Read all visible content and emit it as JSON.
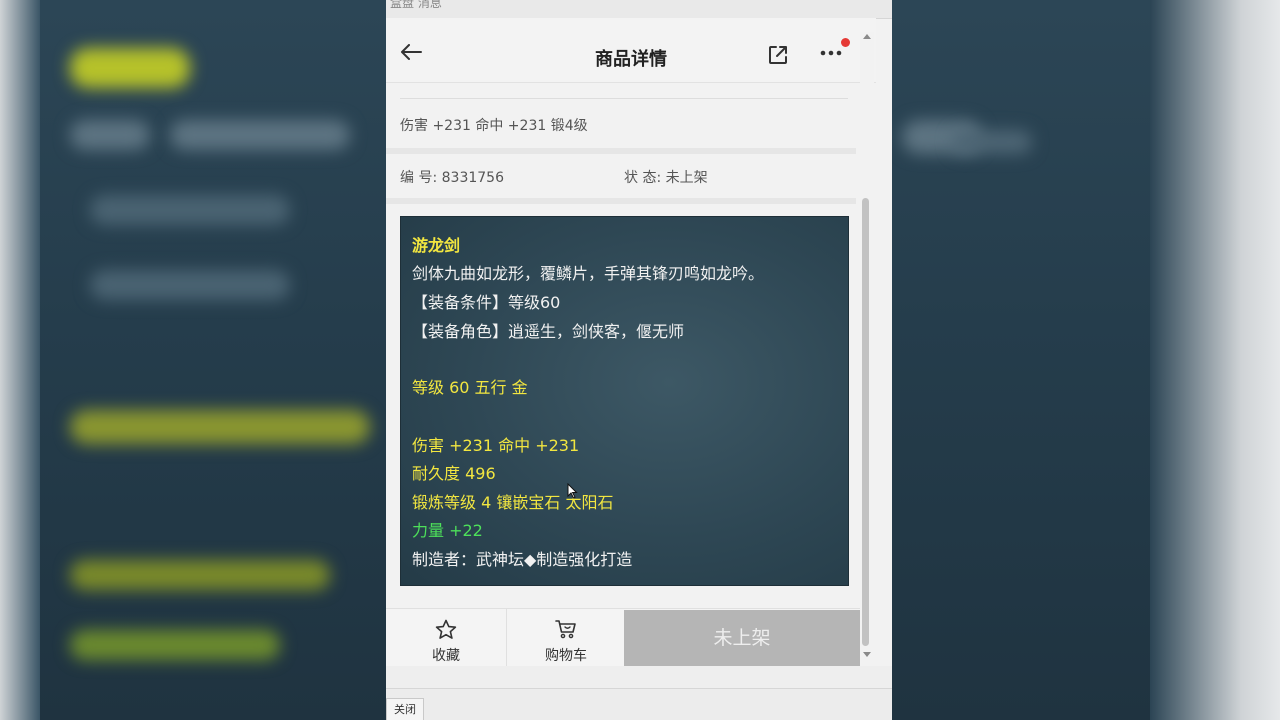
{
  "window": {
    "top_strip_text": "盒盘 消息",
    "footer_close": "关闭"
  },
  "nav": {
    "title": "商品详情",
    "back_icon": "arrow-left-icon",
    "share_icon": "external-link-icon",
    "more_icon": "more-dots-icon",
    "badge_color": "#e53935"
  },
  "item": {
    "stats": "伤害 +231 命中 +231 锻4级",
    "id_label": "编 号:",
    "id_value": "8331756",
    "status_label": "状 态:",
    "status_value": "未上架"
  },
  "description": {
    "name": "游龙剑",
    "flavor": "剑体九曲如龙形，覆鳞片，手弹其锋刃鸣如龙吟。",
    "requirement": "【装备条件】等级60",
    "roles": "【装备角色】逍遥生，剑侠客，偃无师",
    "level_element": "等级 60 五行 金",
    "attack": "伤害 +231 命中 +231",
    "durability": "耐久度 496",
    "forge": "锻炼等级 4 镶嵌宝石 太阳石",
    "bonus": "力量 +22",
    "maker": "制造者：武神坛◆制造强化打造",
    "colors": {
      "yellow": "#f2e640",
      "white": "#f1f1f1",
      "green": "#4de05a"
    }
  },
  "bottom_bar": {
    "favorite_label": "收藏",
    "favorite_icon": "star-icon",
    "cart_label": "购物车",
    "cart_icon": "shopping-cart-icon",
    "status_button_label": "未上架"
  }
}
